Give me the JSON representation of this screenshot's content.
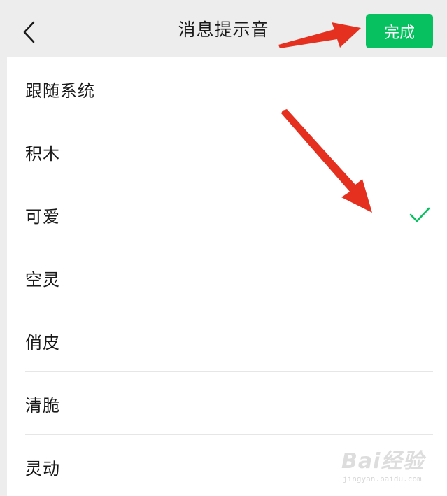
{
  "header": {
    "title": "消息提示音",
    "done_label": "完成",
    "back_icon": "chevron-left-icon"
  },
  "sounds": {
    "selected": "可爱",
    "items": [
      {
        "label": "跟随系统"
      },
      {
        "label": "积木"
      },
      {
        "label": "可爱"
      },
      {
        "label": "空灵"
      },
      {
        "label": "俏皮"
      },
      {
        "label": "清脆"
      },
      {
        "label": "灵动"
      }
    ]
  },
  "watermark": {
    "brand": "Bai经验",
    "url": "jingyan.baidu.com"
  },
  "colors": {
    "accent": "#07c160",
    "annotation_arrow": "#e5301f",
    "background": "#ededed"
  }
}
